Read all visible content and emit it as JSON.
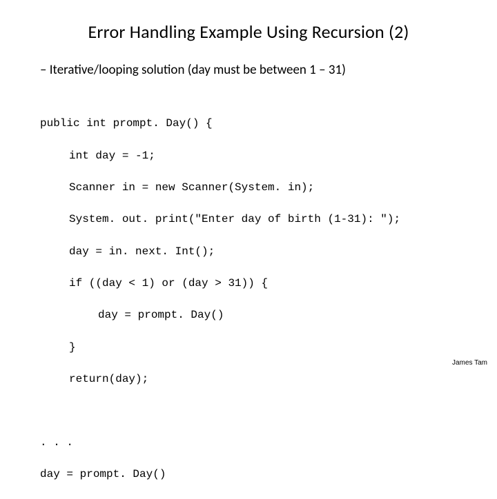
{
  "slide": {
    "title": "Error Handling Example Using Recursion (2)",
    "subtitle": "– Iterative/looping solution (day must be between 1 – 31)",
    "code": {
      "l1": "public int prompt. Day() {",
      "l2": "int day = -1;",
      "l3": "Scanner in = new Scanner(System. in);",
      "l4": "System. out. print(\"Enter day of birth (1-31): \");",
      "l5": "day = in. next. Int();",
      "l6": "if ((day < 1) or (day > 31)) {",
      "l7": "day = prompt. Day()",
      "l8": "}",
      "l9": "return(day);",
      "l10": ". . .",
      "l11": "day = prompt. Day()"
    },
    "footer": "James Tam"
  }
}
